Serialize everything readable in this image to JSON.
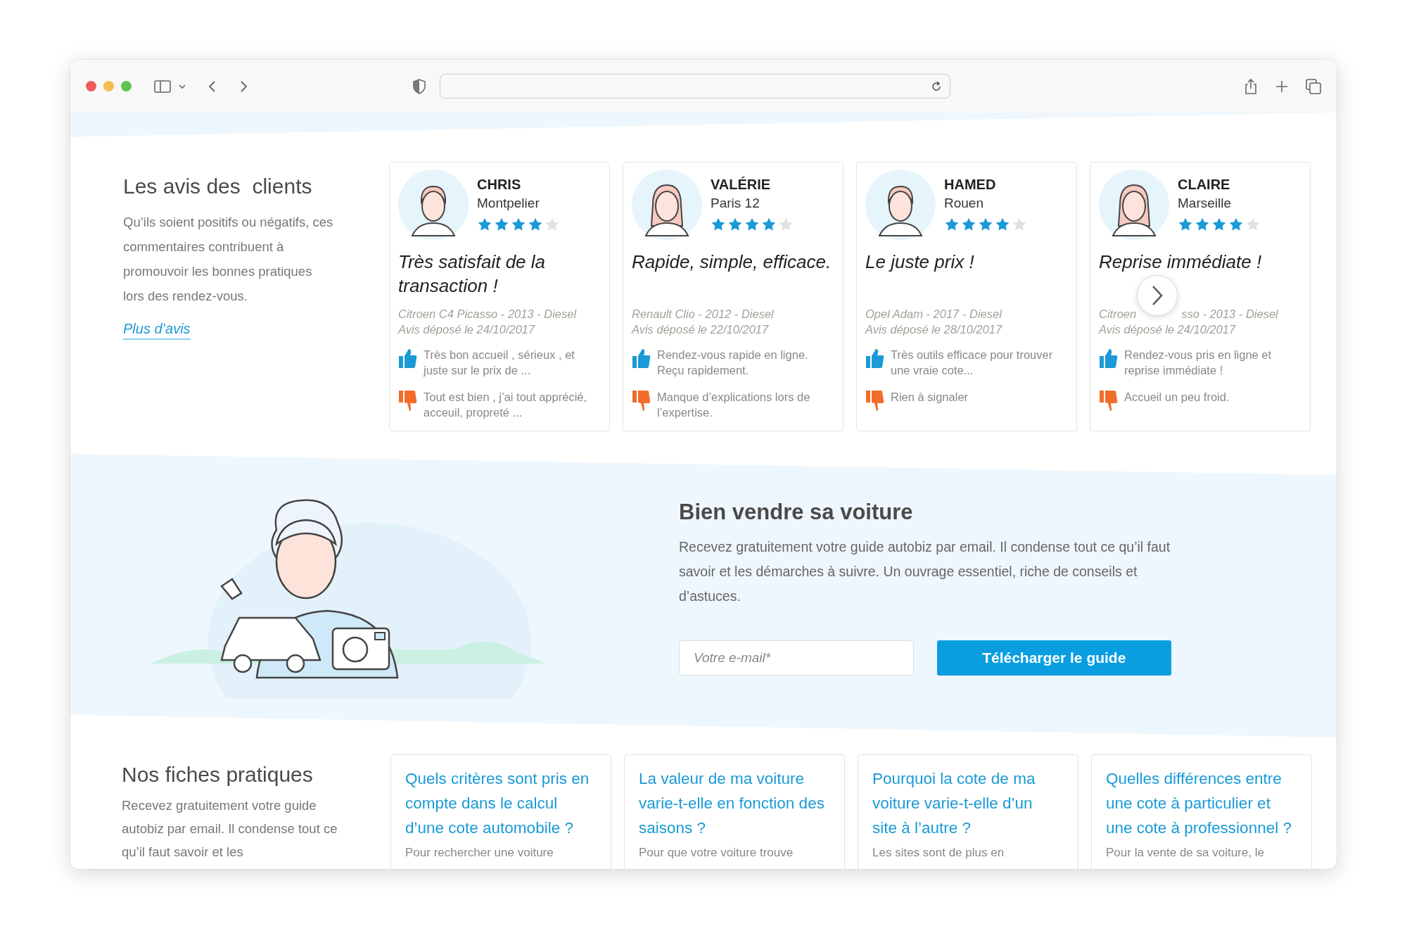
{
  "reviews": {
    "title": "Les avis des  clients",
    "description": "Qu’ils soient positifs ou négatifs, ces commentaires contribuent à promouvoir les bonnes pratiques lors des rendez-vous.",
    "link": "Plus d’avis",
    "cards": [
      {
        "name": "CHRIS",
        "city": "Montpelier",
        "kind": "man",
        "stars": 4,
        "title": "Très satisfait de la transaction !",
        "car": [
          "Citroen C4 Picasso - 2013 - Diesel"
        ],
        "date": "Avis déposé le 24/10/2017",
        "pro": "Très bon accueil , sérieux , et juste sur le prix de ...",
        "con": "Tout est bien , j’ai tout apprécié, acceuil, propreté ..."
      },
      {
        "name": "VALÉRIE",
        "city": "Paris 12",
        "kind": "woman",
        "stars": 4,
        "title": "Rapide, simple, efficace.",
        "car": [
          "Renault Clio - 2012 - Diesel"
        ],
        "date": "Avis déposé le 22/10/2017",
        "pro": "Rendez-vous rapide en ligne. Reçu rapidement.",
        "con": "Manque d’explications lors de l’expertise."
      },
      {
        "name": "HAMED",
        "city": "Rouen",
        "kind": "man",
        "stars": 4,
        "title": "Le juste prix !",
        "car": [
          "Opel Adam - 2017 - Diesel"
        ],
        "date": "Avis déposé le 28/10/2017",
        "pro": "Très outils efficace pour trouver une vraie cote...",
        "con": "Rien à signaler"
      },
      {
        "name": "CLAIRE",
        "city": "Marseille",
        "kind": "woman",
        "stars": 4,
        "title": "Reprise immédiate !",
        "car": [
          "Citroen",
          "sso - 2013 - Diesel"
        ],
        "date": "Avis déposé le 24/10/2017",
        "pro": "Rendez-vous pris en ligne et reprise immédiate !",
        "con": "Accueil un peu froid."
      }
    ]
  },
  "guide": {
    "title": "Bien vendre sa voiture",
    "text": "Recevez gratuitement votre guide autobiz par email. Il condense tout ce qu’il faut savoir et les démarches à suivre. Un ouvrage essentiel, riche de conseils et d’astuces.",
    "email": {
      "placeholder": "Votre e-mail*"
    },
    "button": "Télécharger le guide"
  },
  "sheets": {
    "title": "Nos fiches pratiques",
    "description": "Recevez gratuitement votre guide autobiz par email. Il condense tout ce qu’il faut savoir et les",
    "cards": [
      {
        "title": "Quels critères sont pris en compte dans le calcul d’une cote automobile ?",
        "excerpt": "Pour rechercher une voiture"
      },
      {
        "title": "La valeur de ma voiture varie-t-elle en fonction des saisons ?",
        "excerpt": "Pour que votre voiture trouve"
      },
      {
        "title": "Pourquoi la cote de ma voiture varie-t-elle d’un site à l’autre ?",
        "excerpt": "Les sites sont de plus en"
      },
      {
        "title": "Quelles différences entre une cote à particulier et une cote à professionnel ?",
        "excerpt": "Pour la vente de sa voiture, le"
      }
    ]
  }
}
